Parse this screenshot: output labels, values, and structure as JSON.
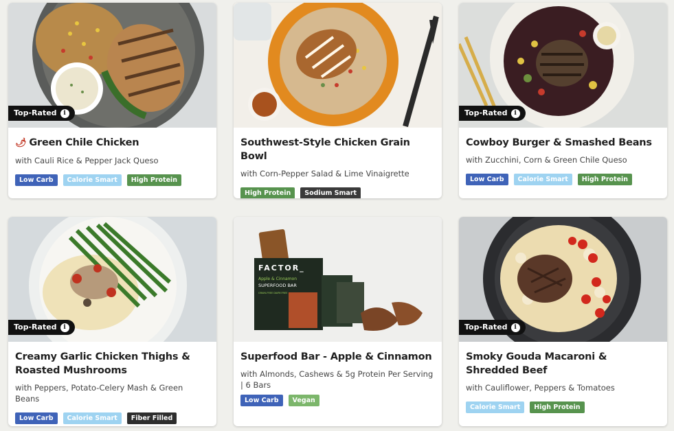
{
  "meals": [
    {
      "title": "Green Chile Chicken",
      "subtitle": "with Cauli Rice & Pepper Jack Queso",
      "top_rated": "Top-Rated",
      "spicy": true,
      "tags": [
        "Low Carb",
        "Calorie Smart",
        "High Protein"
      ]
    },
    {
      "title": "Southwest-Style Chicken Grain Bowl",
      "subtitle": "with Corn-Pepper Salad & Lime Vinaigrette",
      "tags": [
        "High Protein",
        "Sodium Smart"
      ]
    },
    {
      "title": "Cowboy Burger & Smashed Beans",
      "subtitle": "with Zucchini, Corn & Green Chile Queso",
      "top_rated": "Top-Rated",
      "tags": [
        "Low Carb",
        "Calorie Smart",
        "High Protein"
      ]
    },
    {
      "title": "Creamy Garlic Chicken Thighs & Roasted Mushrooms",
      "subtitle": "with Peppers, Potato-Celery Mash & Green Beans",
      "top_rated": "Top-Rated",
      "tags": [
        "Low Carb",
        "Calorie Smart",
        "Fiber Filled"
      ]
    },
    {
      "title": "Superfood Bar - Apple & Cinnamon",
      "subtitle": "with Almonds, Cashews & 5g Protein Per Serving | 6 Bars",
      "tags": [
        "Low Carb",
        "Vegan"
      ],
      "package_text": {
        "brand": "FACTOR_",
        "flavor": "Apple & Cinnamon",
        "product": "SUPERFOOD BAR",
        "claims": "GRAIN-FREE DAIRY-FREE"
      }
    },
    {
      "title": "Smoky Gouda Macaroni & Shredded Beef",
      "subtitle": "with Cauliflower, Peppers & Tomatoes",
      "top_rated": "Top-Rated",
      "tags": [
        "Calorie Smart",
        "High Protein"
      ]
    }
  ],
  "info_icon": "info-icon",
  "spicy_icon": "chili-pepper-icon",
  "colors": {
    "low_carb": "#3f63b8",
    "calorie_smart": "#9ed3f1",
    "high_protein": "#57934e",
    "sodium_smart": "#3a3a3a",
    "fiber_filled": "#2e2e2e",
    "vegan": "#7cb66b",
    "top_rated_bg": "#111111"
  }
}
